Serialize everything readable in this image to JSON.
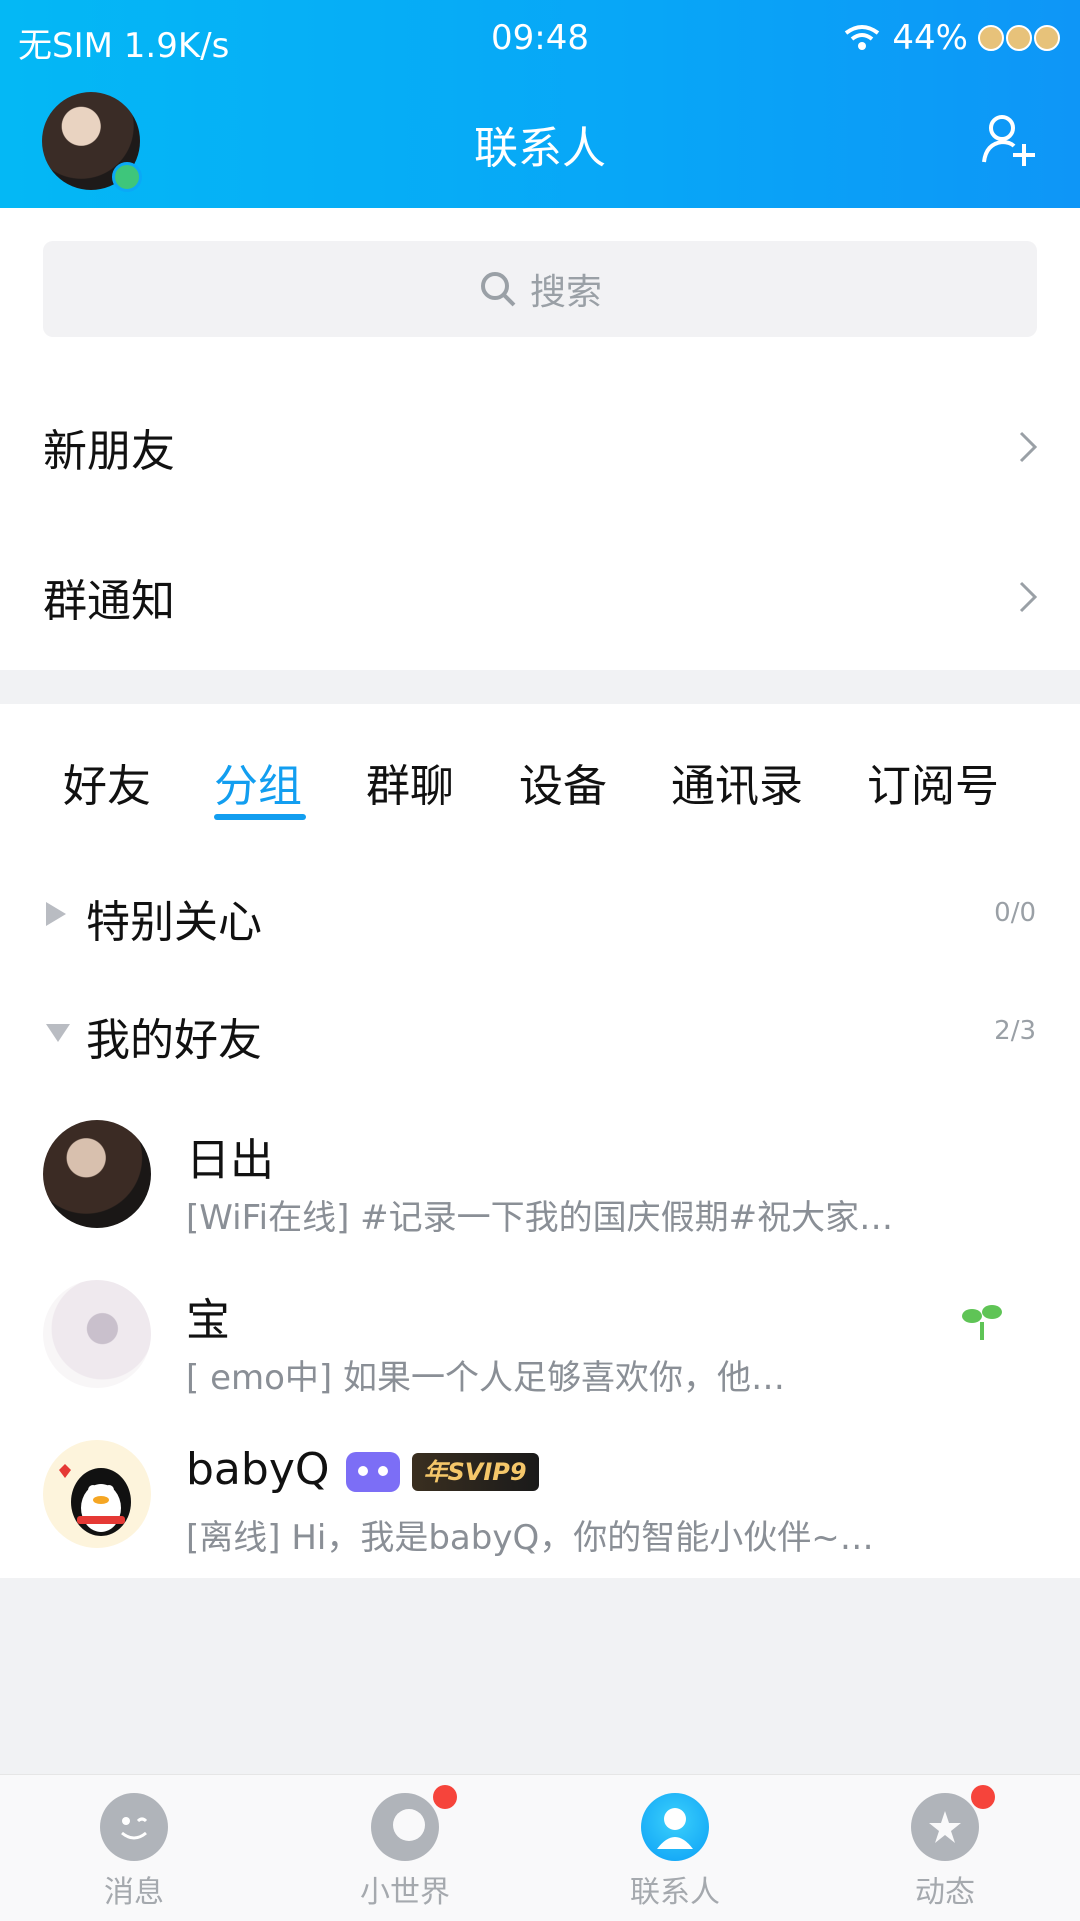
{
  "status_bar": {
    "carrier": "无SIM 1.9K/s",
    "time": "09:48",
    "battery": "44%"
  },
  "header": {
    "title": "联系人"
  },
  "search": {
    "placeholder": "搜索"
  },
  "entries": [
    {
      "label": "新朋友"
    },
    {
      "label": "群通知"
    }
  ],
  "tabs": [
    {
      "label": "好友"
    },
    {
      "label": "分组",
      "active": true
    },
    {
      "label": "群聊"
    },
    {
      "label": "设备"
    },
    {
      "label": "通讯录"
    },
    {
      "label": "订阅号"
    }
  ],
  "groups": [
    {
      "name": "特别关心",
      "count": "0/0",
      "expanded": false
    },
    {
      "name": "我的好友",
      "count": "2/3",
      "expanded": true
    }
  ],
  "friends": [
    {
      "name": "日出",
      "status": "[WiFi在线] #记录一下我的国庆假期#祝大家…"
    },
    {
      "name": "宝",
      "status": "[ emo中] 如果一个人足够喜欢你，他…"
    },
    {
      "name": "babyQ",
      "status": "[离线] Hi，我是babyQ，你的智能小伙伴~…",
      "svip_label": "年SVIP9"
    }
  ],
  "bottom_nav": [
    {
      "label": "消息",
      "icon": "message-icon"
    },
    {
      "label": "小世界",
      "icon": "small-world-icon",
      "dot": true
    },
    {
      "label": "联系人",
      "icon": "contacts-icon",
      "active": true
    },
    {
      "label": "动态",
      "icon": "feed-planet-icon",
      "dot": true
    }
  ],
  "colors": {
    "accent": "#129ef0",
    "header": "#08a6f7",
    "red_dot": "#f6443b"
  }
}
